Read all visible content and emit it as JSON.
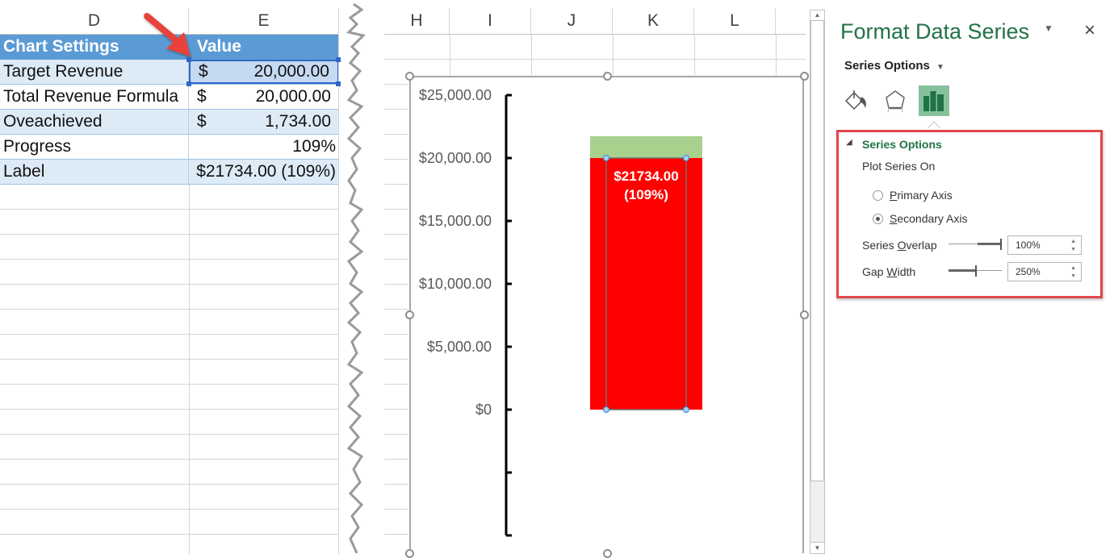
{
  "sheet": {
    "left_columns": [
      "D",
      "E"
    ],
    "right_columns": [
      "H",
      "I",
      "J",
      "K",
      "L"
    ],
    "table": {
      "headers": [
        "Chart Settings",
        "Value"
      ],
      "rows": [
        {
          "label": "Target Revenue",
          "currency": "$",
          "value": "20,000.00",
          "selected": true
        },
        {
          "label": "Total Revenue Formula",
          "currency": "$",
          "value": "20,000.00"
        },
        {
          "label": "Oveachieved",
          "currency": "$",
          "value": "1,734.00"
        },
        {
          "label": "Progress",
          "currency": "",
          "value": "109%"
        },
        {
          "label": "Label",
          "currency": "",
          "value": "$21734.00 (109%)"
        }
      ]
    },
    "annotation_arrow_color": "#e8433b",
    "header_color": "#5b9bd5",
    "band_color": "#ddebf7"
  },
  "chart_data": {
    "type": "bar",
    "stacked": true,
    "categories": [
      ""
    ],
    "series": [
      {
        "name": "Total Revenue",
        "values": [
          20000
        ],
        "color": "#ff0000",
        "axis": "primary"
      },
      {
        "name": "Overachieved",
        "values": [
          1734
        ],
        "color": "#a9d18e",
        "axis": "primary"
      },
      {
        "name": "Target Revenue",
        "values": [
          20000
        ],
        "color": "none",
        "axis": "secondary",
        "selected": true
      }
    ],
    "ylim": [
      -10000,
      25000
    ],
    "yticks": [
      -10000,
      -5000,
      0,
      5000,
      10000,
      15000,
      20000,
      25000
    ],
    "ytick_labels": [
      "",
      "",
      "$0",
      "$5,000.00",
      "$10,000.00",
      "$15,000.00",
      "$20,000.00",
      "$25,000.00"
    ],
    "data_label": [
      "$21734.00",
      "(109%)"
    ],
    "title": "",
    "xlabel": "",
    "ylabel": "",
    "grid": false,
    "legend": "none"
  },
  "pane": {
    "title": "Format Data Series",
    "close_icon": "close-icon",
    "menu_icon": "dropdown-icon",
    "options_dropdown": "Series Options",
    "tabs": [
      {
        "icon": "fill-line-icon",
        "active": false
      },
      {
        "icon": "effects-icon",
        "active": false
      },
      {
        "icon": "series-options-icon",
        "active": true
      }
    ],
    "section": {
      "title": "Series Options",
      "plot_on_label": "Plot Series On",
      "radios": [
        {
          "label": "Primary Axis",
          "accel": "P",
          "rest": "rimary Axis",
          "checked": false
        },
        {
          "label": "Secondary Axis",
          "accel": "S",
          "rest": "econdary Axis",
          "checked": true
        }
      ],
      "overlap": {
        "label_pre": "Series ",
        "accel": "O",
        "label_post": "verlap",
        "value": "100%",
        "fraction": 1.0
      },
      "gap": {
        "label_pre": "Gap ",
        "accel": "W",
        "label_post": "idth",
        "value": "250%",
        "fraction": 0.5
      }
    },
    "highlight_color": "#e0474c",
    "accent": "#217346"
  }
}
